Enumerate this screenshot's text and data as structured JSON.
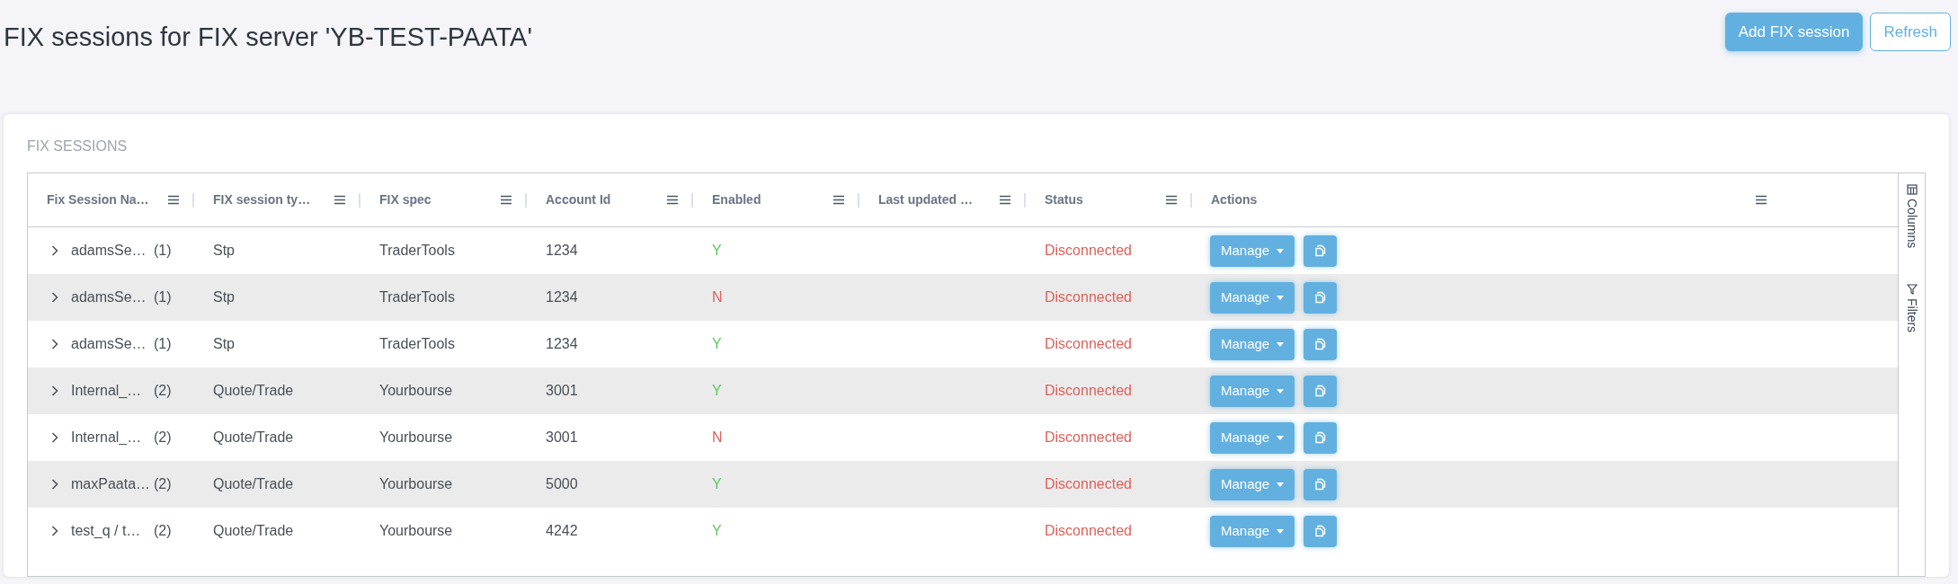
{
  "page": {
    "title": "FIX sessions for FIX server 'YB-TEST-PAATA'",
    "buttons": [
      {
        "label": "Add FIX session",
        "kind": "primary"
      },
      {
        "label": "Refresh",
        "kind": "outline"
      }
    ]
  },
  "card": {
    "title": "FIX SESSIONS"
  },
  "table": {
    "columns": [
      "Fix Session Na…",
      "FIX session ty…",
      "FIX spec",
      "Account Id",
      "Enabled",
      "Last updated …",
      "Status",
      "Actions"
    ],
    "rows": [
      {
        "name": "adamsSe…",
        "count": "(1)",
        "type": "Stp",
        "spec": "TraderTools",
        "account": "1234",
        "enabled_text": "Y",
        "enabled": true,
        "status": "Disconnected",
        "connected": false,
        "action": "Manage"
      },
      {
        "name": "adamsSe…",
        "count": "(1)",
        "type": "Stp",
        "spec": "TraderTools",
        "account": "1234",
        "enabled_text": "N",
        "enabled": false,
        "status": "Disconnected",
        "connected": false,
        "action": "Manage"
      },
      {
        "name": "adamsSe…",
        "count": "(1)",
        "type": "Stp",
        "spec": "TraderTools",
        "account": "1234",
        "enabled_text": "Y",
        "enabled": true,
        "status": "Disconnected",
        "connected": false,
        "action": "Manage"
      },
      {
        "name": "Internal_…",
        "count": "(2)",
        "type": "Quote/Trade",
        "spec": "Yourbourse",
        "account": "3001",
        "enabled_text": "Y",
        "enabled": true,
        "status": "Disconnected",
        "connected": false,
        "action": "Manage"
      },
      {
        "name": "Internal_…",
        "count": "(2)",
        "type": "Quote/Trade",
        "spec": "Yourbourse",
        "account": "3001",
        "enabled_text": "N",
        "enabled": false,
        "status": "Disconnected",
        "connected": false,
        "action": "Manage"
      },
      {
        "name": "maxPaata…",
        "count": "(2)",
        "type": "Quote/Trade",
        "spec": "Yourbourse",
        "account": "5000",
        "enabled_text": "Y",
        "enabled": true,
        "status": "Disconnected",
        "connected": false,
        "action": "Manage"
      },
      {
        "name": "test_q / t…",
        "count": "(2)",
        "type": "Quote/Trade",
        "spec": "Yourbourse",
        "account": "4242",
        "enabled_text": "Y",
        "enabled": true,
        "status": "Disconnected",
        "connected": false,
        "action": "Manage"
      }
    ]
  },
  "side_panel": [
    "Columns",
    "Filters"
  ]
}
